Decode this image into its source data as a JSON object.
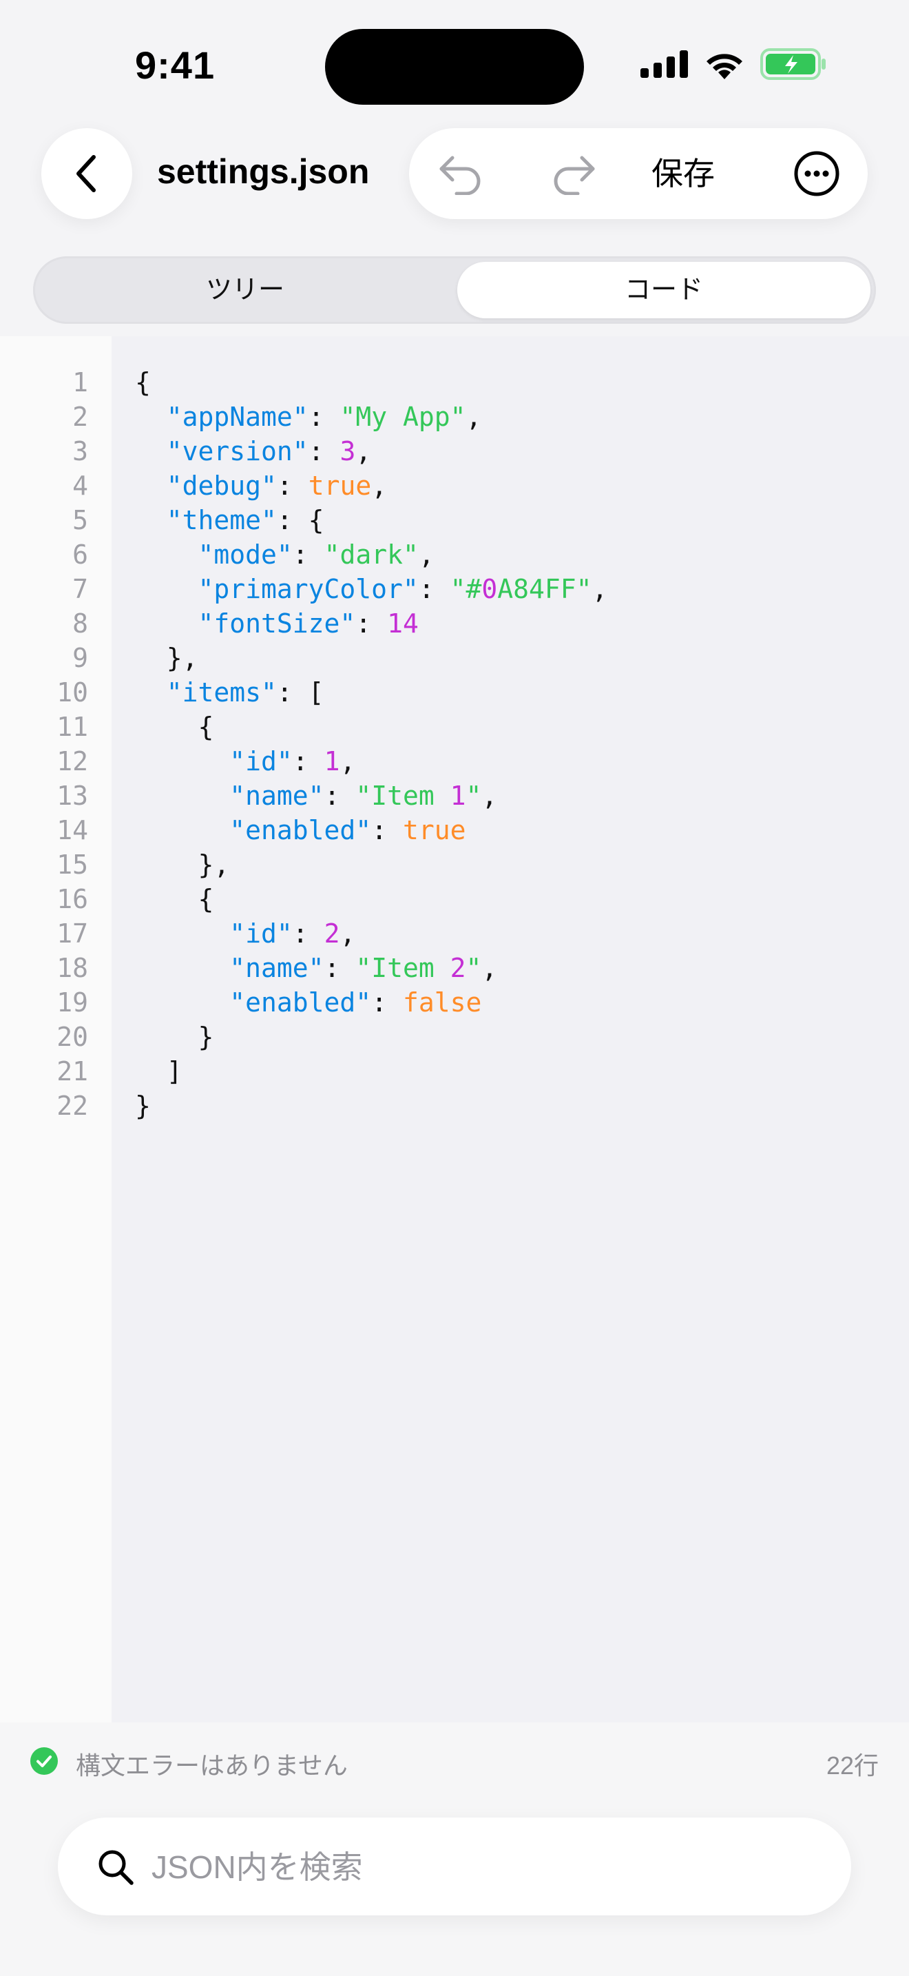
{
  "status_bar": {
    "time": "9:41",
    "icons": [
      "cellular-signal-icon",
      "wifi-icon",
      "battery-charging-icon"
    ],
    "battery_color": "#34c759"
  },
  "nav": {
    "back_icon": "chevron-left-icon",
    "title": "settings.json",
    "toolbar": {
      "undo_icon": "undo-icon",
      "redo_icon": "redo-icon",
      "save_label": "保存",
      "more_icon": "ellipsis-circle-icon"
    }
  },
  "segmented": {
    "tabs": [
      {
        "label": "ツリー",
        "selected": false
      },
      {
        "label": "コード",
        "selected": true
      }
    ]
  },
  "editor": {
    "colors": {
      "key": "#0a84e0",
      "string": "#34c759",
      "number": "#c42fd4",
      "boolean": "#ff8c28",
      "punctuation": "#111111"
    },
    "line_numbers": [
      "1",
      "2",
      "3",
      "4",
      "5",
      "6",
      "7",
      "8",
      "9",
      "10",
      "11",
      "12",
      "13",
      "14",
      "15",
      "16",
      "17",
      "18",
      "19",
      "20",
      "21",
      "22"
    ],
    "lines": [
      [
        {
          "t": "p",
          "v": "{"
        }
      ],
      [
        {
          "t": "p",
          "v": "  "
        },
        {
          "t": "k",
          "v": "\"appName\""
        },
        {
          "t": "p",
          "v": ": "
        },
        {
          "t": "s",
          "v": "\"My App\""
        },
        {
          "t": "p",
          "v": ","
        }
      ],
      [
        {
          "t": "p",
          "v": "  "
        },
        {
          "t": "k",
          "v": "\"version\""
        },
        {
          "t": "p",
          "v": ": "
        },
        {
          "t": "n",
          "v": "3"
        },
        {
          "t": "p",
          "v": ","
        }
      ],
      [
        {
          "t": "p",
          "v": "  "
        },
        {
          "t": "k",
          "v": "\"debug\""
        },
        {
          "t": "p",
          "v": ": "
        },
        {
          "t": "b",
          "v": "true"
        },
        {
          "t": "p",
          "v": ","
        }
      ],
      [
        {
          "t": "p",
          "v": "  "
        },
        {
          "t": "k",
          "v": "\"theme\""
        },
        {
          "t": "p",
          "v": ": {"
        }
      ],
      [
        {
          "t": "p",
          "v": "    "
        },
        {
          "t": "k",
          "v": "\"mode\""
        },
        {
          "t": "p",
          "v": ": "
        },
        {
          "t": "s",
          "v": "\"dark\""
        },
        {
          "t": "p",
          "v": ","
        }
      ],
      [
        {
          "t": "p",
          "v": "    "
        },
        {
          "t": "k",
          "v": "\"primaryColor\""
        },
        {
          "t": "p",
          "v": ": "
        },
        {
          "t": "s",
          "v": "\"#"
        },
        {
          "t": "n",
          "v": "0"
        },
        {
          "t": "s",
          "v": "A84FF\""
        },
        {
          "t": "p",
          "v": ","
        }
      ],
      [
        {
          "t": "p",
          "v": "    "
        },
        {
          "t": "k",
          "v": "\"fontSize\""
        },
        {
          "t": "p",
          "v": ": "
        },
        {
          "t": "n",
          "v": "14"
        }
      ],
      [
        {
          "t": "p",
          "v": "  },"
        }
      ],
      [
        {
          "t": "p",
          "v": "  "
        },
        {
          "t": "k",
          "v": "\"items\""
        },
        {
          "t": "p",
          "v": ": ["
        }
      ],
      [
        {
          "t": "p",
          "v": "    {"
        }
      ],
      [
        {
          "t": "p",
          "v": "      "
        },
        {
          "t": "k",
          "v": "\"id\""
        },
        {
          "t": "p",
          "v": ": "
        },
        {
          "t": "n",
          "v": "1"
        },
        {
          "t": "p",
          "v": ","
        }
      ],
      [
        {
          "t": "p",
          "v": "      "
        },
        {
          "t": "k",
          "v": "\"name\""
        },
        {
          "t": "p",
          "v": ": "
        },
        {
          "t": "s",
          "v": "\"Item "
        },
        {
          "t": "n",
          "v": "1"
        },
        {
          "t": "s",
          "v": "\""
        },
        {
          "t": "p",
          "v": ","
        }
      ],
      [
        {
          "t": "p",
          "v": "      "
        },
        {
          "t": "k",
          "v": "\"enabled\""
        },
        {
          "t": "p",
          "v": ": "
        },
        {
          "t": "b",
          "v": "true"
        }
      ],
      [
        {
          "t": "p",
          "v": "    },"
        }
      ],
      [
        {
          "t": "p",
          "v": "    {"
        }
      ],
      [
        {
          "t": "p",
          "v": "      "
        },
        {
          "t": "k",
          "v": "\"id\""
        },
        {
          "t": "p",
          "v": ": "
        },
        {
          "t": "n",
          "v": "2"
        },
        {
          "t": "p",
          "v": ","
        }
      ],
      [
        {
          "t": "p",
          "v": "      "
        },
        {
          "t": "k",
          "v": "\"name\""
        },
        {
          "t": "p",
          "v": ": "
        },
        {
          "t": "s",
          "v": "\"Item "
        },
        {
          "t": "n",
          "v": "2"
        },
        {
          "t": "s",
          "v": "\""
        },
        {
          "t": "p",
          "v": ","
        }
      ],
      [
        {
          "t": "p",
          "v": "      "
        },
        {
          "t": "k",
          "v": "\"enabled\""
        },
        {
          "t": "p",
          "v": ": "
        },
        {
          "t": "b",
          "v": "false"
        }
      ],
      [
        {
          "t": "p",
          "v": "    }"
        }
      ],
      [
        {
          "t": "p",
          "v": "  ]"
        }
      ],
      [
        {
          "t": "p",
          "v": "}"
        }
      ]
    ]
  },
  "footer": {
    "status_icon": "checkmark-circle-icon",
    "status_color": "#34c759",
    "status_text": "構文エラーはありません",
    "line_count": "22行",
    "search": {
      "icon": "search-icon",
      "placeholder": "JSON内を検索",
      "value": ""
    }
  }
}
